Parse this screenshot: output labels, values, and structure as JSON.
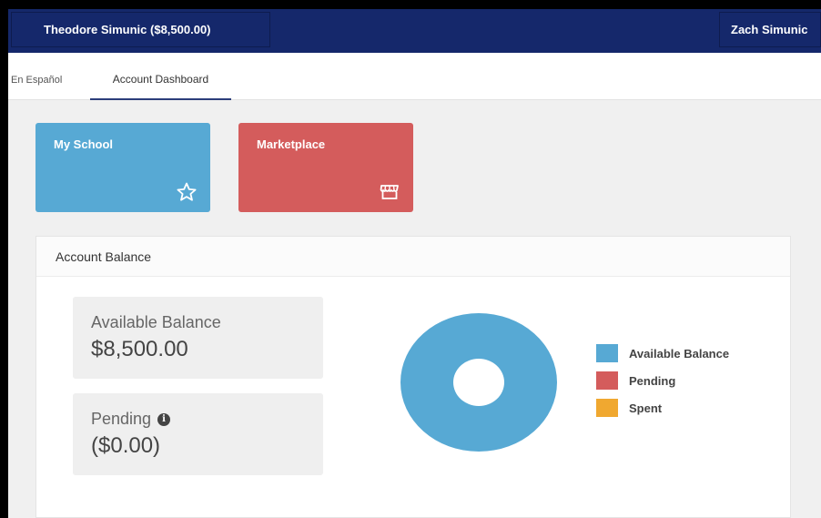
{
  "header": {
    "account_label": "Theodore Simunic ($8,500.00)",
    "user_name": "Zach Simunic"
  },
  "tabs": {
    "language_link": "En Español",
    "dashboard_tab": "Account Dashboard"
  },
  "tiles": [
    {
      "label": "My School",
      "icon": "star-icon",
      "color": "#57a9d4"
    },
    {
      "label": "Marketplace",
      "icon": "storefront-icon",
      "color": "#d45c5c"
    }
  ],
  "account_balance": {
    "title": "Account Balance",
    "available_label": "Available Balance",
    "available_value": "$8,500.00",
    "pending_label": "Pending",
    "pending_value": "($0.00)"
  },
  "chart_data": {
    "type": "pie",
    "categories": [
      "Available Balance",
      "Pending",
      "Spent"
    ],
    "values": [
      8500,
      0,
      0
    ],
    "colors": [
      "#57a9d4",
      "#d45c5c",
      "#f0a830"
    ],
    "legend_position": "right"
  }
}
